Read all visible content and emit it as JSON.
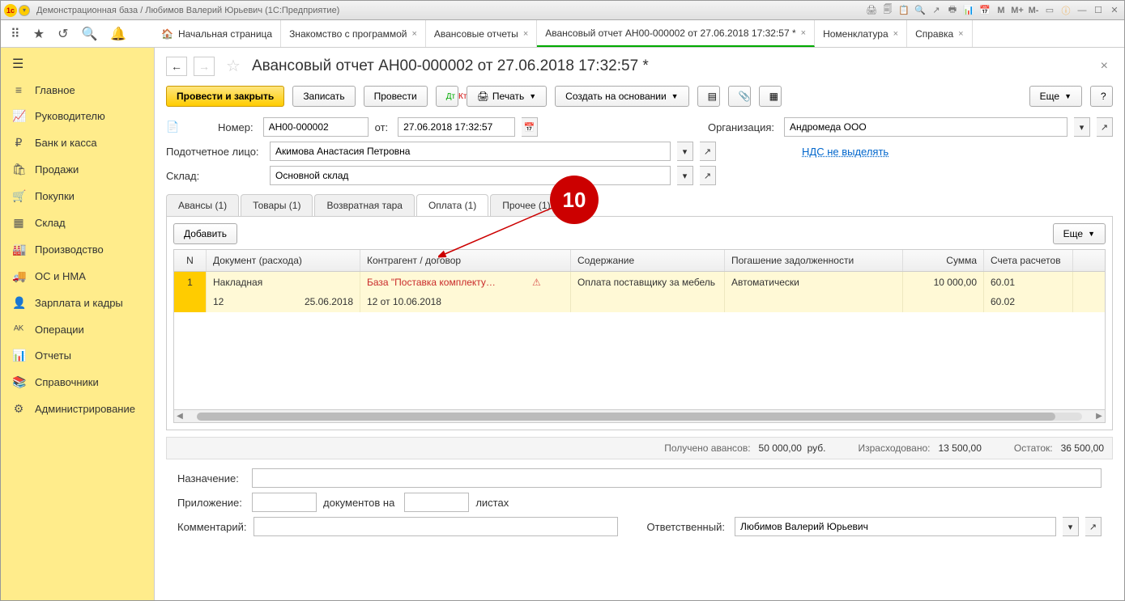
{
  "titlebar": {
    "title": "Демонстрационная база / Любимов Валерий Юрьевич  (1С:Предприятие)"
  },
  "toolbar": {
    "home_tab": "Начальная страница",
    "tabs": [
      {
        "label": "Знакомство с программой"
      },
      {
        "label": "Авансовые отчеты"
      },
      {
        "label": "Авансовый отчет АН00-000002 от 27.06.2018 17:32:57 *",
        "active": true
      },
      {
        "label": "Номенклатура"
      },
      {
        "label": "Справка"
      }
    ]
  },
  "sidebar": {
    "items": [
      {
        "icon": "≡",
        "label": "Главное"
      },
      {
        "icon": "📈",
        "label": "Руководителю"
      },
      {
        "icon": "₽",
        "label": "Банк и касса"
      },
      {
        "icon": "🛍",
        "label": "Продажи"
      },
      {
        "icon": "🛒",
        "label": "Покупки"
      },
      {
        "icon": "▦",
        "label": "Склад"
      },
      {
        "icon": "🏭",
        "label": "Производство"
      },
      {
        "icon": "🚚",
        "label": "ОС и НМА"
      },
      {
        "icon": "👤",
        "label": "Зарплата и кадры"
      },
      {
        "icon": "ᴬᴷ",
        "label": "Операции"
      },
      {
        "icon": "📊",
        "label": "Отчеты"
      },
      {
        "icon": "📚",
        "label": "Справочники"
      },
      {
        "icon": "⚙",
        "label": "Администрирование"
      }
    ]
  },
  "doc": {
    "title": "Авансовый отчет АН00-000002 от 27.06.2018 17:32:57 *",
    "btn_save_close": "Провести и закрыть",
    "btn_write": "Записать",
    "btn_post": "Провести",
    "btn_print": "Печать",
    "btn_create_based": "Создать на основании",
    "btn_more": "Еще",
    "lbl_number": "Номер:",
    "number": "АН00-000002",
    "lbl_from": "от:",
    "date": "27.06.2018 17:32:57",
    "lbl_org": "Организация:",
    "org": "Андромеда ООО",
    "lbl_person": "Подотчетное лицо:",
    "person": "Акимова Анастасия Петровна",
    "link_vat": "НДС не выделять",
    "lbl_warehouse": "Склад:",
    "warehouse": "Основной склад",
    "doc_tabs": [
      {
        "label": "Авансы (1)"
      },
      {
        "label": "Товары (1)"
      },
      {
        "label": "Возвратная тара"
      },
      {
        "label": "Оплата (1)",
        "active": true
      },
      {
        "label": "Прочее (1)"
      }
    ],
    "btn_add": "Добавить",
    "table": {
      "headers": {
        "n": "N",
        "doc": "Документ (расхода)",
        "contractor": "Контрагент / договор",
        "content": "Содержание",
        "debt": "Погашение задолженности",
        "sum": "Сумма",
        "account": "Счета расчетов"
      },
      "row1": {
        "n": "1",
        "doc": "Накладная",
        "contractor": "База \"Поставка комплекту…",
        "content": "Оплата поставщику за мебель",
        "debt": "Автоматически",
        "sum": "10 000,00",
        "account": "60.01"
      },
      "row2": {
        "doc_num": "12",
        "doc_date": "25.06.2018",
        "contract": "12 от 10.06.2018",
        "account": "60.02"
      }
    },
    "totals": {
      "lbl_received": "Получено авансов:",
      "received": "50 000,00",
      "received_cur": "руб.",
      "lbl_spent": "Израсходовано:",
      "spent": "13 500,00",
      "lbl_balance": "Остаток:",
      "balance": "36 500,00"
    },
    "footer": {
      "lbl_purpose": "Назначение:",
      "lbl_attachment": "Приложение:",
      "lbl_docs_on": "документов на",
      "lbl_sheets": "листах",
      "lbl_comment": "Комментарий:",
      "lbl_responsible": "Ответственный:",
      "responsible": "Любимов Валерий Юрьевич"
    }
  },
  "annotation": {
    "num": "10"
  }
}
